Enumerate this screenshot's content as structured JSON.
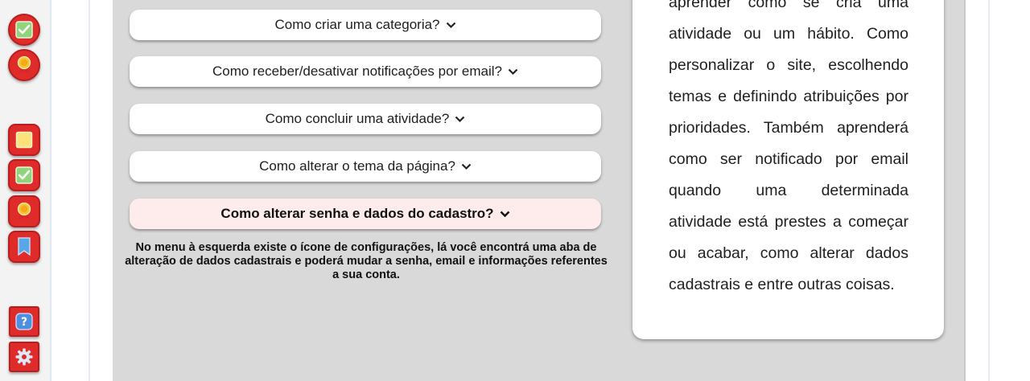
{
  "sidebar": {
    "buttons": [
      {
        "icon": "check-icon"
      },
      {
        "icon": "award-ribbon-icon"
      },
      {
        "icon": "note-icon"
      },
      {
        "icon": "check-icon"
      },
      {
        "icon": "award-ribbon-icon"
      },
      {
        "icon": "bookmark-icon"
      },
      {
        "icon": "help-icon",
        "label": "?"
      },
      {
        "icon": "gear-icon"
      }
    ]
  },
  "faq": {
    "items": [
      {
        "question": "Como criar uma categoria?"
      },
      {
        "question": "Como receber/desativar notificações por email?"
      },
      {
        "question": "Como concluir uma atividade?"
      },
      {
        "question": "Como alterar o tema da página?"
      },
      {
        "question": "Como alterar senha e dados do cadastro?"
      }
    ],
    "active_answer": "No menu à esquerda existe o ícone de configurações, lá você encontrá uma aba de alteração de dados cadastrais e poderá mudar a senha, email e informações referentes a sua conta."
  },
  "info_card": {
    "text": "aprender como se cria uma atividade ou um hábito. Como personalizar o site, escolhendo temas e definindo atribuições por prioridades. Também aprenderá como ser notificado por email quando uma determinada atividade está prestes a começar ou acabar, como alterar dados cadastrais e entre outras coisas."
  },
  "colors": {
    "accent_red": "#e02b2b",
    "content_bg": "#d9d9d9",
    "active_item_bg": "#fdeceb"
  }
}
